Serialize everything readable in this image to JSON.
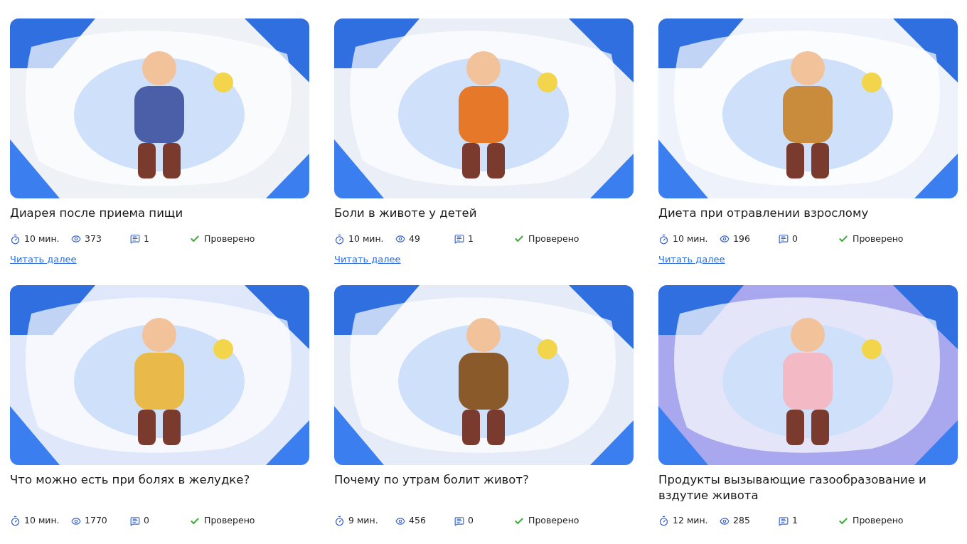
{
  "articles": [
    {
      "title": "Диарея после приема пищи",
      "read_time": "10 мин.",
      "views": "373",
      "comments": "1",
      "verified_label": "Проверено",
      "link": "Читать далее"
    },
    {
      "title": "Боли в животе у детей",
      "read_time": "10 мин.",
      "views": "49",
      "comments": "1",
      "verified_label": "Проверено",
      "link": "Читать далее"
    },
    {
      "title": "Диета при отравлении взрослому",
      "read_time": "10 мин.",
      "views": "196",
      "comments": "0",
      "verified_label": "Проверено",
      "link": "Читать далее"
    },
    {
      "title": "Что можно есть при болях в желудке?",
      "read_time": "10 мин.",
      "views": "1770",
      "comments": "0",
      "verified_label": "Проверено"
    },
    {
      "title": "Почему по утрам болит живот?",
      "read_time": "9 мин.",
      "views": "456",
      "comments": "0",
      "verified_label": "Проверено"
    },
    {
      "title": "Продукты вызывающие газообразование и вздутие живота",
      "read_time": "12 мин.",
      "views": "285",
      "comments": "1",
      "verified_label": "Проверено"
    }
  ]
}
